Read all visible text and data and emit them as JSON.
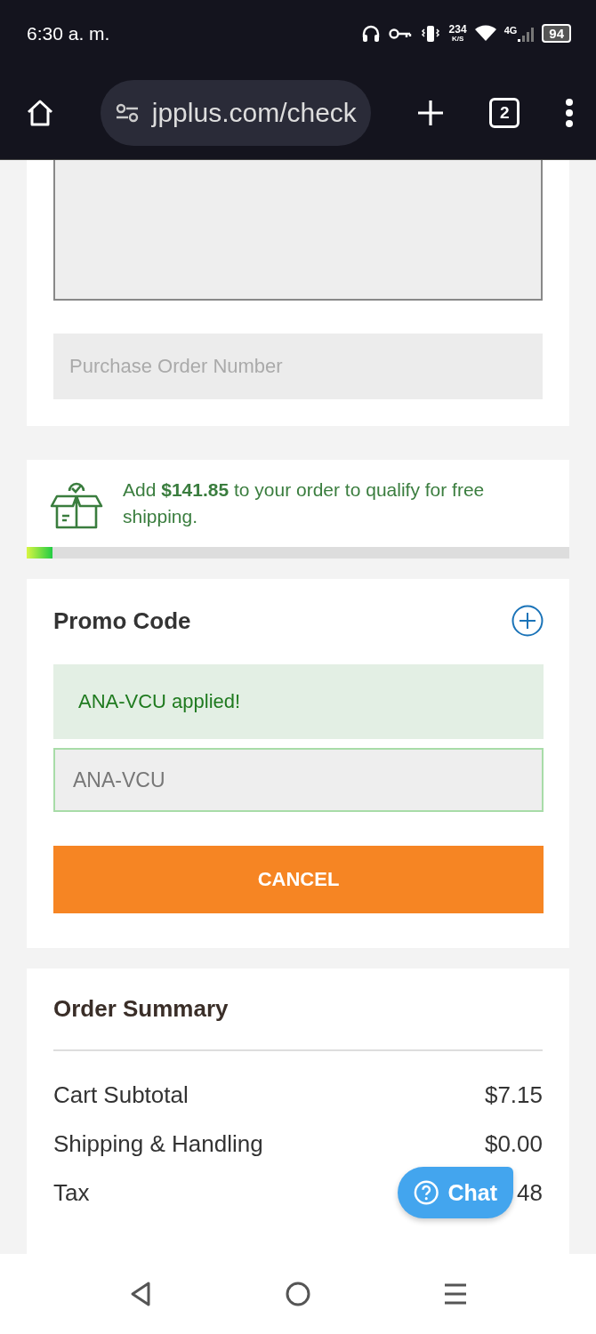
{
  "status_bar": {
    "time": "6:30 a. m.",
    "speed": "234",
    "speed_unit": "K/S",
    "network": "4G",
    "battery": "94"
  },
  "browser": {
    "url": "jpplus.com/check",
    "tab_count": "2"
  },
  "order_details": {
    "po_placeholder": "Purchase Order Number"
  },
  "free_shipping": {
    "message": "Add **$141.85** to your order to qualify for free shipping.",
    "level": 0.047
  },
  "promo": {
    "title": "Promo Code",
    "notice": "ANA-VCU applied!",
    "code": "ANA-VCU",
    "button": "CANCEL"
  },
  "summary": {
    "title": "Order Summary",
    "rows": [
      {
        "label": "Cart Subtotal",
        "value": "$7.15"
      },
      {
        "label": "Shipping & Handling",
        "value": "$0.00"
      },
      {
        "label": "Tax",
        "value": "48"
      }
    ]
  },
  "chat": {
    "label": "Chat"
  }
}
